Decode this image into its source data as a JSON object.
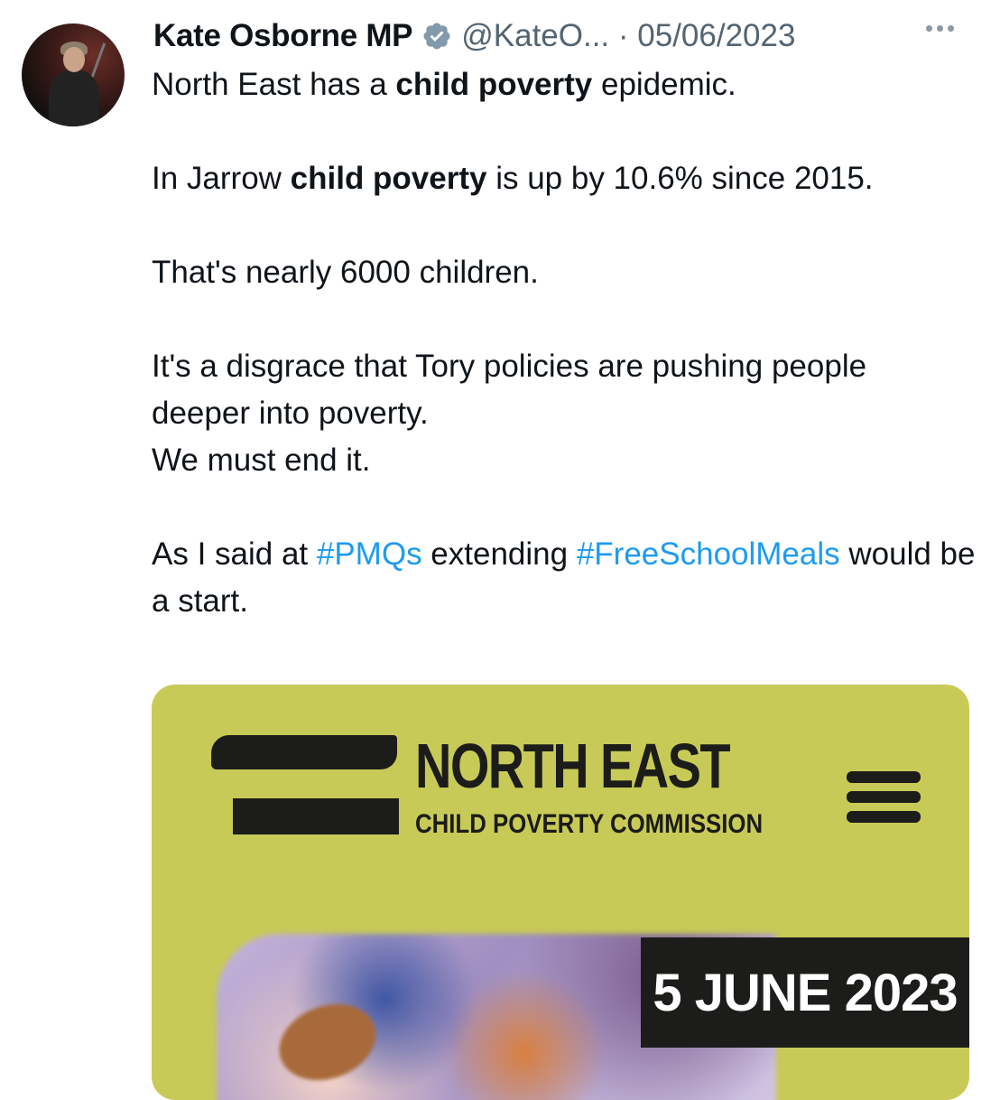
{
  "tweet": {
    "author_name": "Kate Osborne MP",
    "handle_date": "@KateO... · 05/06/2023",
    "paragraphs": {
      "p1": {
        "a": "North East has a ",
        "b": "child poverty",
        "c": " epidemic."
      },
      "p2": {
        "a": "In Jarrow ",
        "b": "child poverty",
        "c": " is up by 10.6% since 2015."
      },
      "p3": "That's nearly 6000 children.",
      "p4": "It's a disgrace that Tory policies are pushing people deeper into poverty.",
      "p5": "We must end it.",
      "p6": {
        "a": "As I said at ",
        "tag1": "#PMQs",
        "b": " extending ",
        "tag2": "#FreeSchoolMeals",
        "c": " would be a start."
      }
    },
    "icons": {
      "verified": "verified-badge-icon",
      "more": "more-options-icon"
    },
    "colors": {
      "hashtag": "#1d9bf0",
      "secondary_text": "#536471",
      "media_bg": "#c8ca57"
    }
  },
  "media": {
    "title": "NORTH EAST",
    "subtitle": "CHILD POVERTY COMMISSION",
    "date": "5 JUNE 2023"
  }
}
